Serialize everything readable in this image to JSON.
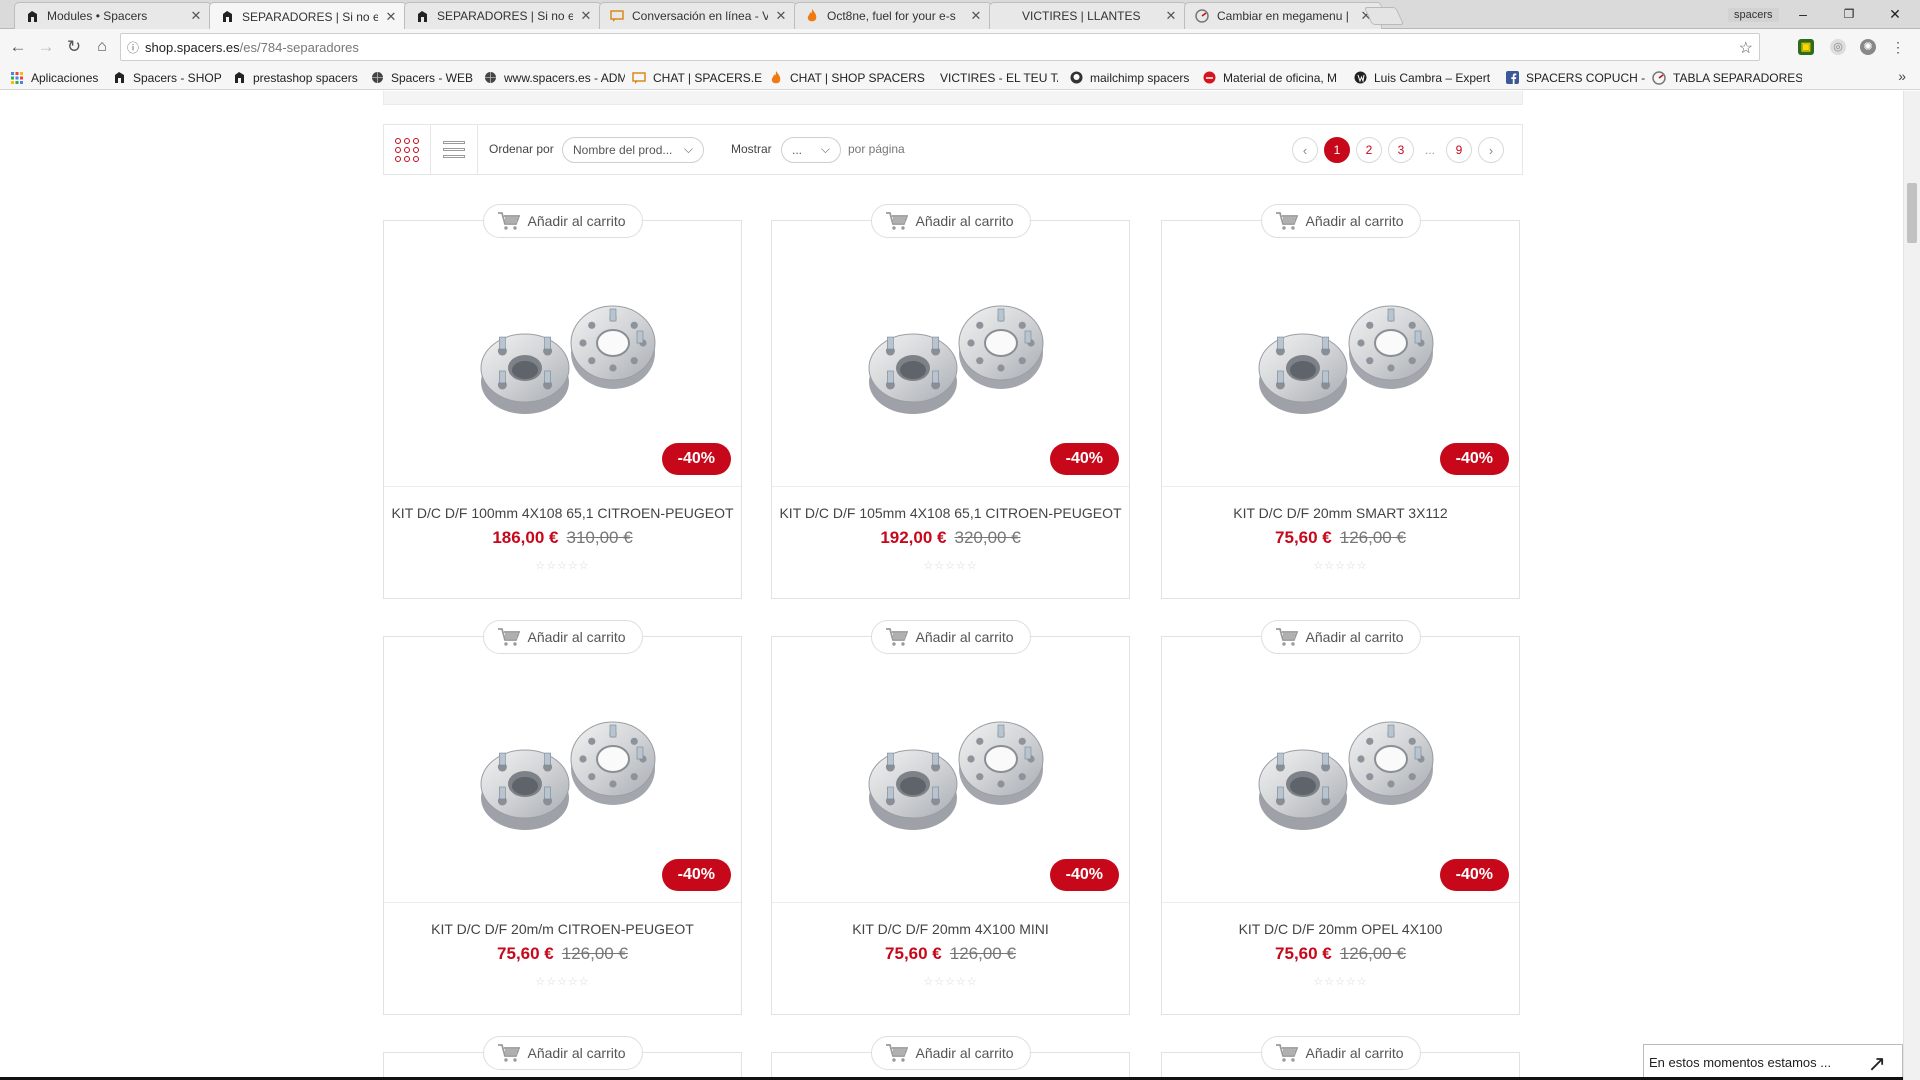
{
  "browser": {
    "tabs": [
      {
        "title": "Modules • Spacers",
        "icon": "spacers-favicon",
        "active": false
      },
      {
        "title": "SEPARADORES | Si no en",
        "icon": "spacers-favicon",
        "active": true
      },
      {
        "title": "SEPARADORES | Si no en",
        "icon": "spacers-favicon",
        "active": false
      },
      {
        "title": "Conversación en línea - V",
        "icon": "chat-favicon",
        "active": false
      },
      {
        "title": "Oct8ne, fuel for your e-s",
        "icon": "flame-favicon",
        "active": false
      },
      {
        "title": "VICTIRES | LLANTES",
        "icon": "none",
        "active": false
      },
      {
        "title": "Cambiar en megamenu |",
        "icon": "gauge-favicon",
        "active": false
      }
    ],
    "profile_label": "spacers",
    "window_controls": {
      "minimize": "–",
      "restore": "❐",
      "close": "✕"
    },
    "url_host": "shop.spacers.es",
    "url_path": "/es/784-separadores",
    "bookmarks": [
      {
        "label": "Aplicaciones",
        "icon": "apps-grid-icon"
      },
      {
        "label": "Spacers - SHOP",
        "icon": "spacers-favicon"
      },
      {
        "label": "prestashop spacers",
        "icon": "spacers-favicon"
      },
      {
        "label": "Spacers - WEB",
        "icon": "globe-icon"
      },
      {
        "label": "www.spacers.es - ADM",
        "icon": "globe-icon"
      },
      {
        "label": "CHAT | SPACERS.ES",
        "icon": "chat-favicon"
      },
      {
        "label": "CHAT | SHOP SPACERS",
        "icon": "flame-favicon"
      },
      {
        "label": "VICTIRES - EL TEU TALL",
        "icon": "none"
      },
      {
        "label": "mailchimp spacers",
        "icon": "mailchimp-icon"
      },
      {
        "label": "Material de oficina, M",
        "icon": "office-icon"
      },
      {
        "label": "Luis Cambra – Expert",
        "icon": "wordpress-icon"
      },
      {
        "label": "SPACERS COPUCH - I",
        "icon": "facebook-icon"
      },
      {
        "label": "TABLA SEPARADORES",
        "icon": "gauge-favicon"
      }
    ],
    "bookmarks_more": "»"
  },
  "colors": {
    "accent": "#c7081a",
    "price": "#c7081a"
  },
  "toolbar": {
    "sort_label": "Ordenar por",
    "sort_value": "Nombre del prod...",
    "show_label": "Mostrar",
    "show_value": "...",
    "per_page_label": "por página",
    "pages": [
      "1",
      "2",
      "3",
      "...",
      "9"
    ],
    "current_page": "1",
    "prev_icon": "‹",
    "next_icon": "›"
  },
  "products": [
    {
      "name": "KIT D/C D/F 100mm 4X108 65,1 CITROEN-PEUGEOT",
      "price": "186,00 €",
      "old_price": "310,00 €",
      "discount": "-40%",
      "cart_label": "Añadir al carrito"
    },
    {
      "name": "KIT D/C D/F 105mm 4X108 65,1 CITROEN-PEUGEOT",
      "price": "192,00 €",
      "old_price": "320,00 €",
      "discount": "-40%",
      "cart_label": "Añadir al carrito"
    },
    {
      "name": "KIT D/C D/F 20mm SMART 3X112",
      "price": "75,60 €",
      "old_price": "126,00 €",
      "discount": "-40%",
      "cart_label": "Añadir al carrito"
    },
    {
      "name": "KIT D/C D/F 20m/m CITROEN-PEUGEOT",
      "price": "75,60 €",
      "old_price": "126,00 €",
      "discount": "-40%",
      "cart_label": "Añadir al carrito"
    },
    {
      "name": "KIT D/C D/F 20mm 4X100 MINI",
      "price": "75,60 €",
      "old_price": "126,00 €",
      "discount": "-40%",
      "cart_label": "Añadir al carrito"
    },
    {
      "name": "KIT D/C D/F 20mm OPEL 4X100",
      "price": "75,60 €",
      "old_price": "126,00 €",
      "discount": "-40%",
      "cart_label": "Añadir al carrito"
    }
  ],
  "partial_row_cart_label": "Añadir al carrito",
  "rating": {
    "stars_filled": 0,
    "stars_total": 5
  },
  "chat_widget": {
    "text": "En estos momentos estamos ..."
  }
}
